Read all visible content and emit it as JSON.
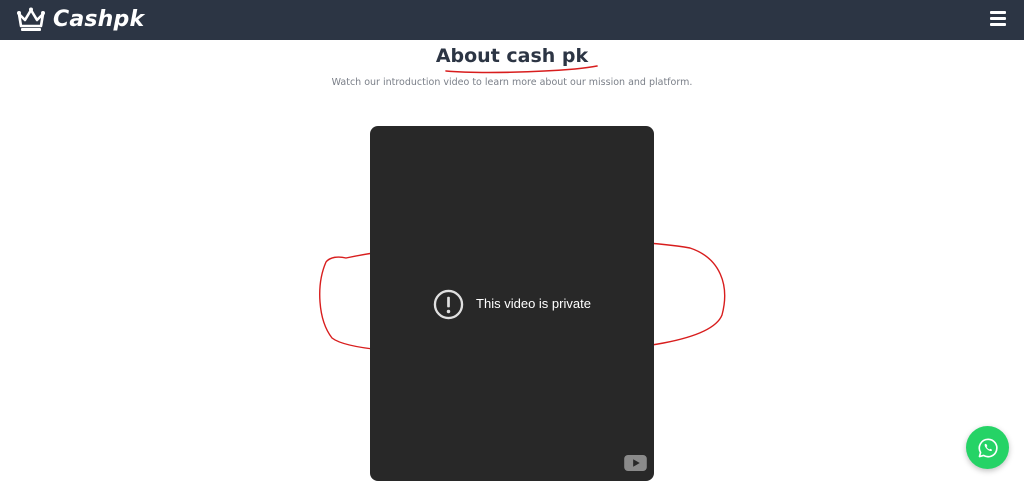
{
  "header": {
    "brand_name": "Cashpk",
    "brand_icon": "crown-icon",
    "menu_icon": "hamburger-menu-icon"
  },
  "main": {
    "title": "About cash pk",
    "subtitle": "Watch our introduction video to learn more about our mission and platform."
  },
  "video": {
    "message": "This video is private",
    "status_icon": "exclamation-circle-icon",
    "logo_icon": "youtube-icon"
  },
  "floating": {
    "chat_icon": "whatsapp-icon"
  },
  "colors": {
    "navbar_bg": "#2c3544",
    "title_text": "#2c3544",
    "annotation_red": "#d81d1d",
    "video_bg": "#282828",
    "whatsapp_green": "#25d366"
  }
}
